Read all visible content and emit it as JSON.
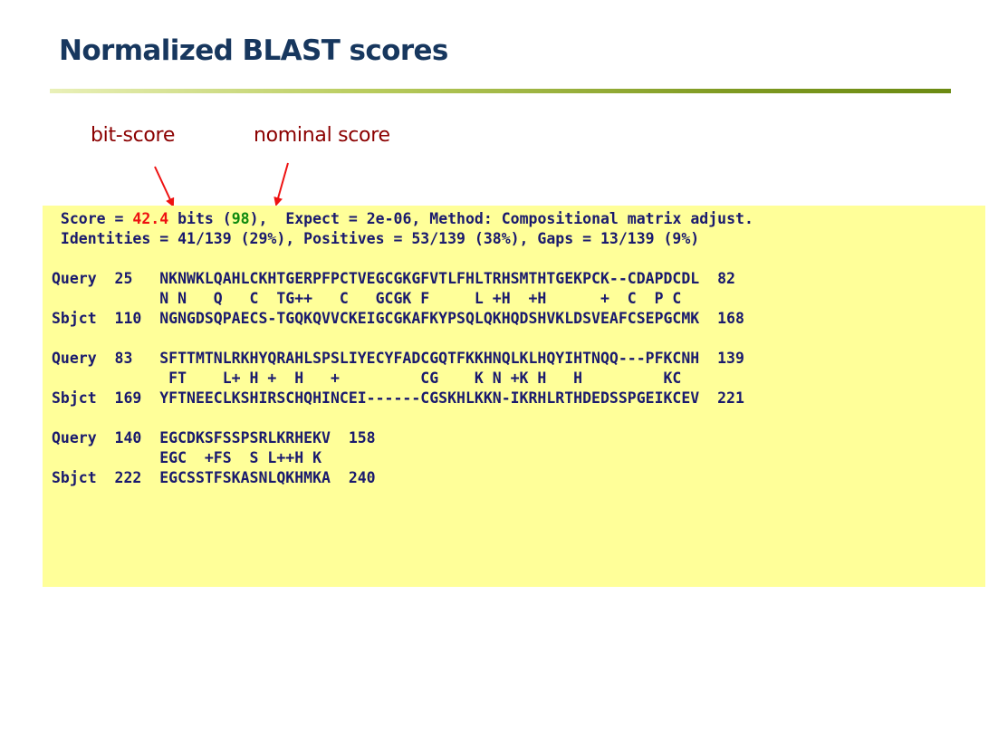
{
  "title": "Normalized BLAST scores",
  "annotations": {
    "bit_score_label": "bit-score",
    "nominal_score_label": "nominal score"
  },
  "colors": {
    "title": "#17375e",
    "annotation": "#8b0000",
    "arrow": "#ee1111",
    "bit_score_value": "#ee1111",
    "nominal_score_value": "#0f8a0f",
    "panel_background": "#ffff99",
    "alignment_text": "#1a1a6e"
  },
  "blast": {
    "score_prefix": " Score = ",
    "bit_score": "42.4",
    "bits_text": " bits (",
    "nominal_score": "98",
    "score_suffix": "),  Expect = 2e-06, Method: Compositional matrix adjust.",
    "identities_line": " Identities = 41/139 (29%), Positives = 53/139 (38%), Gaps = 13/139 (9%)",
    "blocks": [
      {
        "query": "Query  25   NKNWKLQAHLCKHTGERPFPCTVEGCGKGFVTLFHLTRHSMTHTGEKPCK--CDAPDCDL  82",
        "match": "            N N   Q   C  TG++   C   GCGK F     L +H  +H      +  C  P C",
        "sbjct": "Sbjct  110  NGNGDSQPAECS-TGQKQVVCKEIGCGKAFKYPSQLQKHQDSHVKLDSVEAFCSEPGCMK  168"
      },
      {
        "query": "Query  83   SFTTMTNLRKHYQRAHLSPSLIYECYFADCGQTFKKHNQLKLHQYIHTNQQ---PFKCNH  139",
        "match": "             FT    L+ H +  H   +         CG    K N +K H   H         KC",
        "sbjct": "Sbjct  169  YFTNEECLKSHIRSCHQHINCEI------CGSKHLKKN-IKRHLRTHDEDSSPGEIKCEV  221"
      },
      {
        "query": "Query  140  EGCDKSFSSPSRLKRHEKV  158",
        "match": "            EGC  +FS  S L++H K",
        "sbjct": "Sbjct  222  EGCSSTFSKASNLQKHMKA  240"
      }
    ]
  }
}
